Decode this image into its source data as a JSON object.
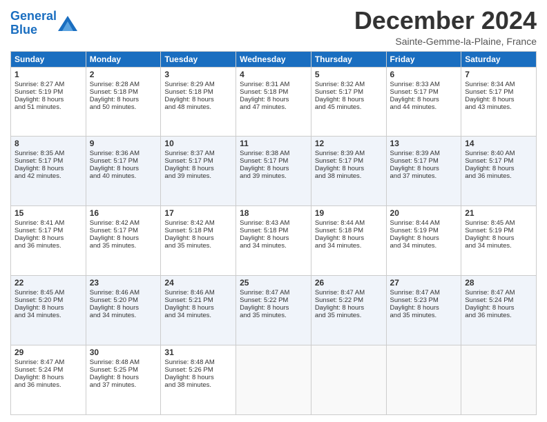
{
  "header": {
    "logo_line1": "General",
    "logo_line2": "Blue",
    "month_title": "December 2024",
    "subtitle": "Sainte-Gemme-la-Plaine, France"
  },
  "days_of_week": [
    "Sunday",
    "Monday",
    "Tuesday",
    "Wednesday",
    "Thursday",
    "Friday",
    "Saturday"
  ],
  "weeks": [
    [
      {
        "day": "1",
        "lines": [
          "Sunrise: 8:27 AM",
          "Sunset: 5:19 PM",
          "Daylight: 8 hours",
          "and 51 minutes."
        ]
      },
      {
        "day": "2",
        "lines": [
          "Sunrise: 8:28 AM",
          "Sunset: 5:18 PM",
          "Daylight: 8 hours",
          "and 50 minutes."
        ]
      },
      {
        "day": "3",
        "lines": [
          "Sunrise: 8:29 AM",
          "Sunset: 5:18 PM",
          "Daylight: 8 hours",
          "and 48 minutes."
        ]
      },
      {
        "day": "4",
        "lines": [
          "Sunrise: 8:31 AM",
          "Sunset: 5:18 PM",
          "Daylight: 8 hours",
          "and 47 minutes."
        ]
      },
      {
        "day": "5",
        "lines": [
          "Sunrise: 8:32 AM",
          "Sunset: 5:17 PM",
          "Daylight: 8 hours",
          "and 45 minutes."
        ]
      },
      {
        "day": "6",
        "lines": [
          "Sunrise: 8:33 AM",
          "Sunset: 5:17 PM",
          "Daylight: 8 hours",
          "and 44 minutes."
        ]
      },
      {
        "day": "7",
        "lines": [
          "Sunrise: 8:34 AM",
          "Sunset: 5:17 PM",
          "Daylight: 8 hours",
          "and 43 minutes."
        ]
      }
    ],
    [
      {
        "day": "8",
        "lines": [
          "Sunrise: 8:35 AM",
          "Sunset: 5:17 PM",
          "Daylight: 8 hours",
          "and 42 minutes."
        ]
      },
      {
        "day": "9",
        "lines": [
          "Sunrise: 8:36 AM",
          "Sunset: 5:17 PM",
          "Daylight: 8 hours",
          "and 40 minutes."
        ]
      },
      {
        "day": "10",
        "lines": [
          "Sunrise: 8:37 AM",
          "Sunset: 5:17 PM",
          "Daylight: 8 hours",
          "and 39 minutes."
        ]
      },
      {
        "day": "11",
        "lines": [
          "Sunrise: 8:38 AM",
          "Sunset: 5:17 PM",
          "Daylight: 8 hours",
          "and 39 minutes."
        ]
      },
      {
        "day": "12",
        "lines": [
          "Sunrise: 8:39 AM",
          "Sunset: 5:17 PM",
          "Daylight: 8 hours",
          "and 38 minutes."
        ]
      },
      {
        "day": "13",
        "lines": [
          "Sunrise: 8:39 AM",
          "Sunset: 5:17 PM",
          "Daylight: 8 hours",
          "and 37 minutes."
        ]
      },
      {
        "day": "14",
        "lines": [
          "Sunrise: 8:40 AM",
          "Sunset: 5:17 PM",
          "Daylight: 8 hours",
          "and 36 minutes."
        ]
      }
    ],
    [
      {
        "day": "15",
        "lines": [
          "Sunrise: 8:41 AM",
          "Sunset: 5:17 PM",
          "Daylight: 8 hours",
          "and 36 minutes."
        ]
      },
      {
        "day": "16",
        "lines": [
          "Sunrise: 8:42 AM",
          "Sunset: 5:17 PM",
          "Daylight: 8 hours",
          "and 35 minutes."
        ]
      },
      {
        "day": "17",
        "lines": [
          "Sunrise: 8:42 AM",
          "Sunset: 5:18 PM",
          "Daylight: 8 hours",
          "and 35 minutes."
        ]
      },
      {
        "day": "18",
        "lines": [
          "Sunrise: 8:43 AM",
          "Sunset: 5:18 PM",
          "Daylight: 8 hours",
          "and 34 minutes."
        ]
      },
      {
        "day": "19",
        "lines": [
          "Sunrise: 8:44 AM",
          "Sunset: 5:18 PM",
          "Daylight: 8 hours",
          "and 34 minutes."
        ]
      },
      {
        "day": "20",
        "lines": [
          "Sunrise: 8:44 AM",
          "Sunset: 5:19 PM",
          "Daylight: 8 hours",
          "and 34 minutes."
        ]
      },
      {
        "day": "21",
        "lines": [
          "Sunrise: 8:45 AM",
          "Sunset: 5:19 PM",
          "Daylight: 8 hours",
          "and 34 minutes."
        ]
      }
    ],
    [
      {
        "day": "22",
        "lines": [
          "Sunrise: 8:45 AM",
          "Sunset: 5:20 PM",
          "Daylight: 8 hours",
          "and 34 minutes."
        ]
      },
      {
        "day": "23",
        "lines": [
          "Sunrise: 8:46 AM",
          "Sunset: 5:20 PM",
          "Daylight: 8 hours",
          "and 34 minutes."
        ]
      },
      {
        "day": "24",
        "lines": [
          "Sunrise: 8:46 AM",
          "Sunset: 5:21 PM",
          "Daylight: 8 hours",
          "and 34 minutes."
        ]
      },
      {
        "day": "25",
        "lines": [
          "Sunrise: 8:47 AM",
          "Sunset: 5:22 PM",
          "Daylight: 8 hours",
          "and 35 minutes."
        ]
      },
      {
        "day": "26",
        "lines": [
          "Sunrise: 8:47 AM",
          "Sunset: 5:22 PM",
          "Daylight: 8 hours",
          "and 35 minutes."
        ]
      },
      {
        "day": "27",
        "lines": [
          "Sunrise: 8:47 AM",
          "Sunset: 5:23 PM",
          "Daylight: 8 hours",
          "and 35 minutes."
        ]
      },
      {
        "day": "28",
        "lines": [
          "Sunrise: 8:47 AM",
          "Sunset: 5:24 PM",
          "Daylight: 8 hours",
          "and 36 minutes."
        ]
      }
    ],
    [
      {
        "day": "29",
        "lines": [
          "Sunrise: 8:47 AM",
          "Sunset: 5:24 PM",
          "Daylight: 8 hours",
          "and 36 minutes."
        ]
      },
      {
        "day": "30",
        "lines": [
          "Sunrise: 8:48 AM",
          "Sunset: 5:25 PM",
          "Daylight: 8 hours",
          "and 37 minutes."
        ]
      },
      {
        "day": "31",
        "lines": [
          "Sunrise: 8:48 AM",
          "Sunset: 5:26 PM",
          "Daylight: 8 hours",
          "and 38 minutes."
        ]
      },
      {
        "day": "",
        "lines": []
      },
      {
        "day": "",
        "lines": []
      },
      {
        "day": "",
        "lines": []
      },
      {
        "day": "",
        "lines": []
      }
    ]
  ]
}
